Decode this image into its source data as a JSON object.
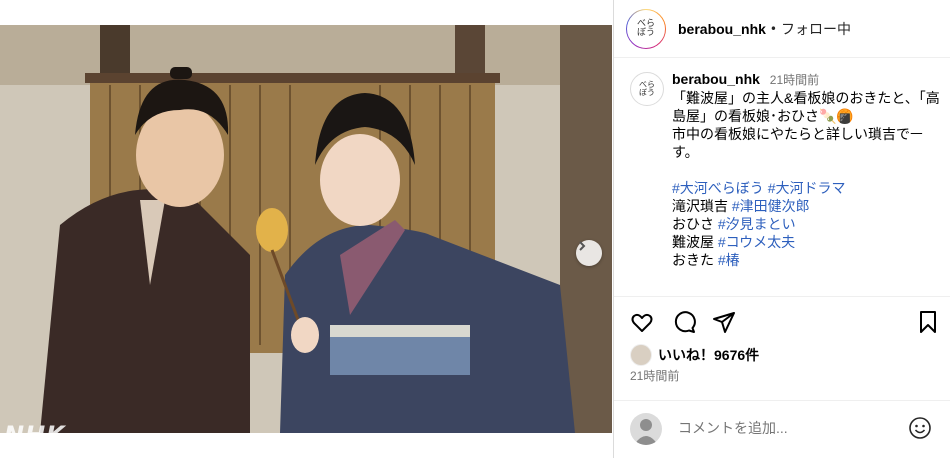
{
  "post": {
    "media_watermark": "NHK",
    "carousel_dots": 2,
    "carousel_active": 0
  },
  "header": {
    "username": "berabou_nhk",
    "separator": "•",
    "follow_status": "フォロー中"
  },
  "caption": {
    "username": "berabou_nhk",
    "time": "21時間前",
    "lines": [
      "「難波屋」の主人&看板娘のおきたと、「高",
      "島屋」の看板娘･おひさ🍡🍘",
      "市中の看板娘にやたらと詳しい瑣吉でￚ",
      "す。"
    ],
    "hashtags_line": [
      "#大河べらぼう",
      "#大河ドラマ"
    ],
    "cast": [
      {
        "role": "滝沢瑣吉",
        "tag": "#津田健次郎"
      },
      {
        "role": "おひさ",
        "tag": "#汐見まとい"
      },
      {
        "role": "難波屋",
        "tag": "#コウメ太夫"
      },
      {
        "role": "おきた",
        "tag": "#椿"
      }
    ]
  },
  "likes": {
    "text": "いいね！9676件"
  },
  "post_time": "21時間前",
  "comment": {
    "placeholder": "コメントを追加..."
  }
}
